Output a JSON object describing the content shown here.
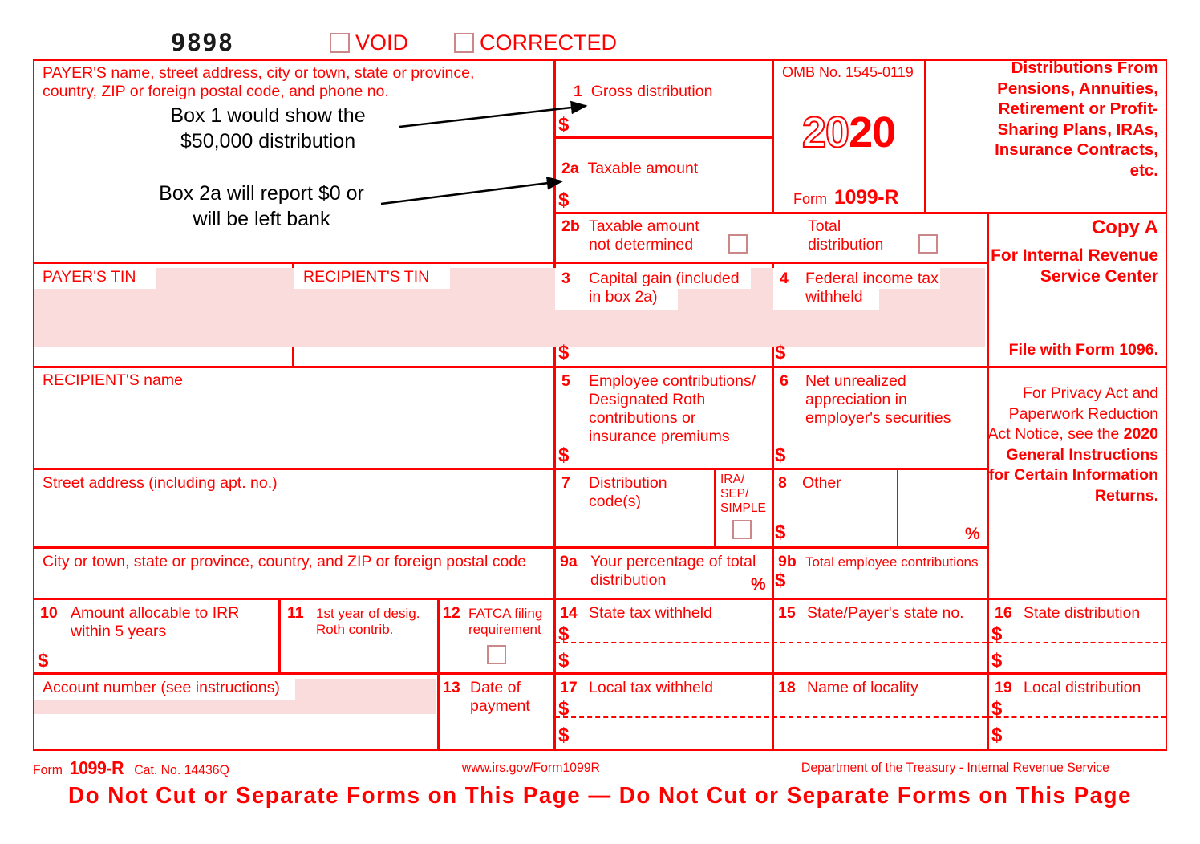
{
  "form": {
    "void_number": "9898",
    "void_label": "VOID",
    "corrected_label": "CORRECTED",
    "omb": "OMB No. 1545-0119",
    "year_hollow": "20",
    "year_solid": "20",
    "form_word": "Form",
    "form_number": "1099-R",
    "title": "Distributions From\nPensions, Annuities,\nRetirement or\nProfit-Sharing Plans,\nIRAs, Insurance\nContracts, etc.",
    "copy_a": "Copy A",
    "for_irs": "For\nInternal Revenue\nService Center",
    "file_with": "File with Form 1096.",
    "privacy_regular": "For Privacy Act and Paperwork Reduction Act Notice, see the ",
    "privacy_bold": "2020 General Instructions for Certain Information Returns."
  },
  "boxes": {
    "payer_block": "PAYER'S name, street address, city or town, state or province,\ncountry, ZIP or foreign postal code, and phone no.",
    "payer_tin": "PAYER'S TIN",
    "recipient_tin": "RECIPIENT'S TIN",
    "recipient_name": "RECIPIENT'S name",
    "street_address": "Street address (including apt. no.)",
    "city_line": "City or town, state or province, country, and ZIP or foreign postal code",
    "account_number": "Account number (see instructions)",
    "b1_num": "1",
    "b1_label": "Gross distribution",
    "b2a_num": "2a",
    "b2a_label": "Taxable amount",
    "b2b_num": "2b",
    "b2b_label": "Taxable amount\nnot determined",
    "total_distribution_label": "Total\ndistribution",
    "b3_num": "3",
    "b3_label": "Capital gain (included\nin box 2a)",
    "b4_num": "4",
    "b4_label": "Federal income tax\nwithheld",
    "b5_num": "5",
    "b5_label": "Employee contributions/\nDesignated Roth\ncontributions or\ninsurance premiums",
    "b6_num": "6",
    "b6_label": "Net unrealized\nappreciation in\nemployer's securities",
    "b7_num": "7",
    "b7_label": "Distribution\ncode(s)",
    "ira_sep_simple": "IRA/\nSEP/\nSIMPLE",
    "b8_num": "8",
    "b8_label": "Other",
    "b9a_num": "9a",
    "b9a_label": "Your percentage of total\ndistribution",
    "b9b_num": "9b",
    "b9b_label": "Total employee contributions",
    "b10_num": "10",
    "b10_label": "Amount allocable to IRR\nwithin 5 years",
    "b11_num": "11",
    "b11_label": "1st year of desig.\nRoth contrib.",
    "b12_num": "12",
    "b12_label": "FATCA filing\nrequirement",
    "b13_num": "13",
    "b13_label": "Date of\npayment",
    "b14_num": "14",
    "b14_label": "State tax withheld",
    "b15_num": "15",
    "b15_label": "State/Payer's state no.",
    "b16_num": "16",
    "b16_label": "State distribution",
    "b17_num": "17",
    "b17_label": "Local tax withheld",
    "b18_num": "18",
    "b18_label": "Name of locality",
    "b19_num": "19",
    "b19_label": "Local distribution",
    "dollar": "$",
    "percent": "%"
  },
  "annotations": {
    "note1": "Box 1 would show the\n$50,000 distribution",
    "note2": "Box 2a will report $0 or\nwill be left bank"
  },
  "footer": {
    "form_word": "Form",
    "form_number": "1099-R",
    "cat_no": "Cat. No. 14436Q",
    "website": "www.irs.gov/Form1099R",
    "department": "Department of the Treasury - Internal Revenue Service",
    "do_not_cut": "Do Not Cut or Separate Forms on This Page  —   Do Not Cut or Separate Forms on This Page"
  },
  "colors": {
    "red": "#ff0000",
    "pink_fill": "#fbdcdc",
    "checkbox_border": "#cc8888",
    "annotation_black": "#1a1a1a"
  }
}
